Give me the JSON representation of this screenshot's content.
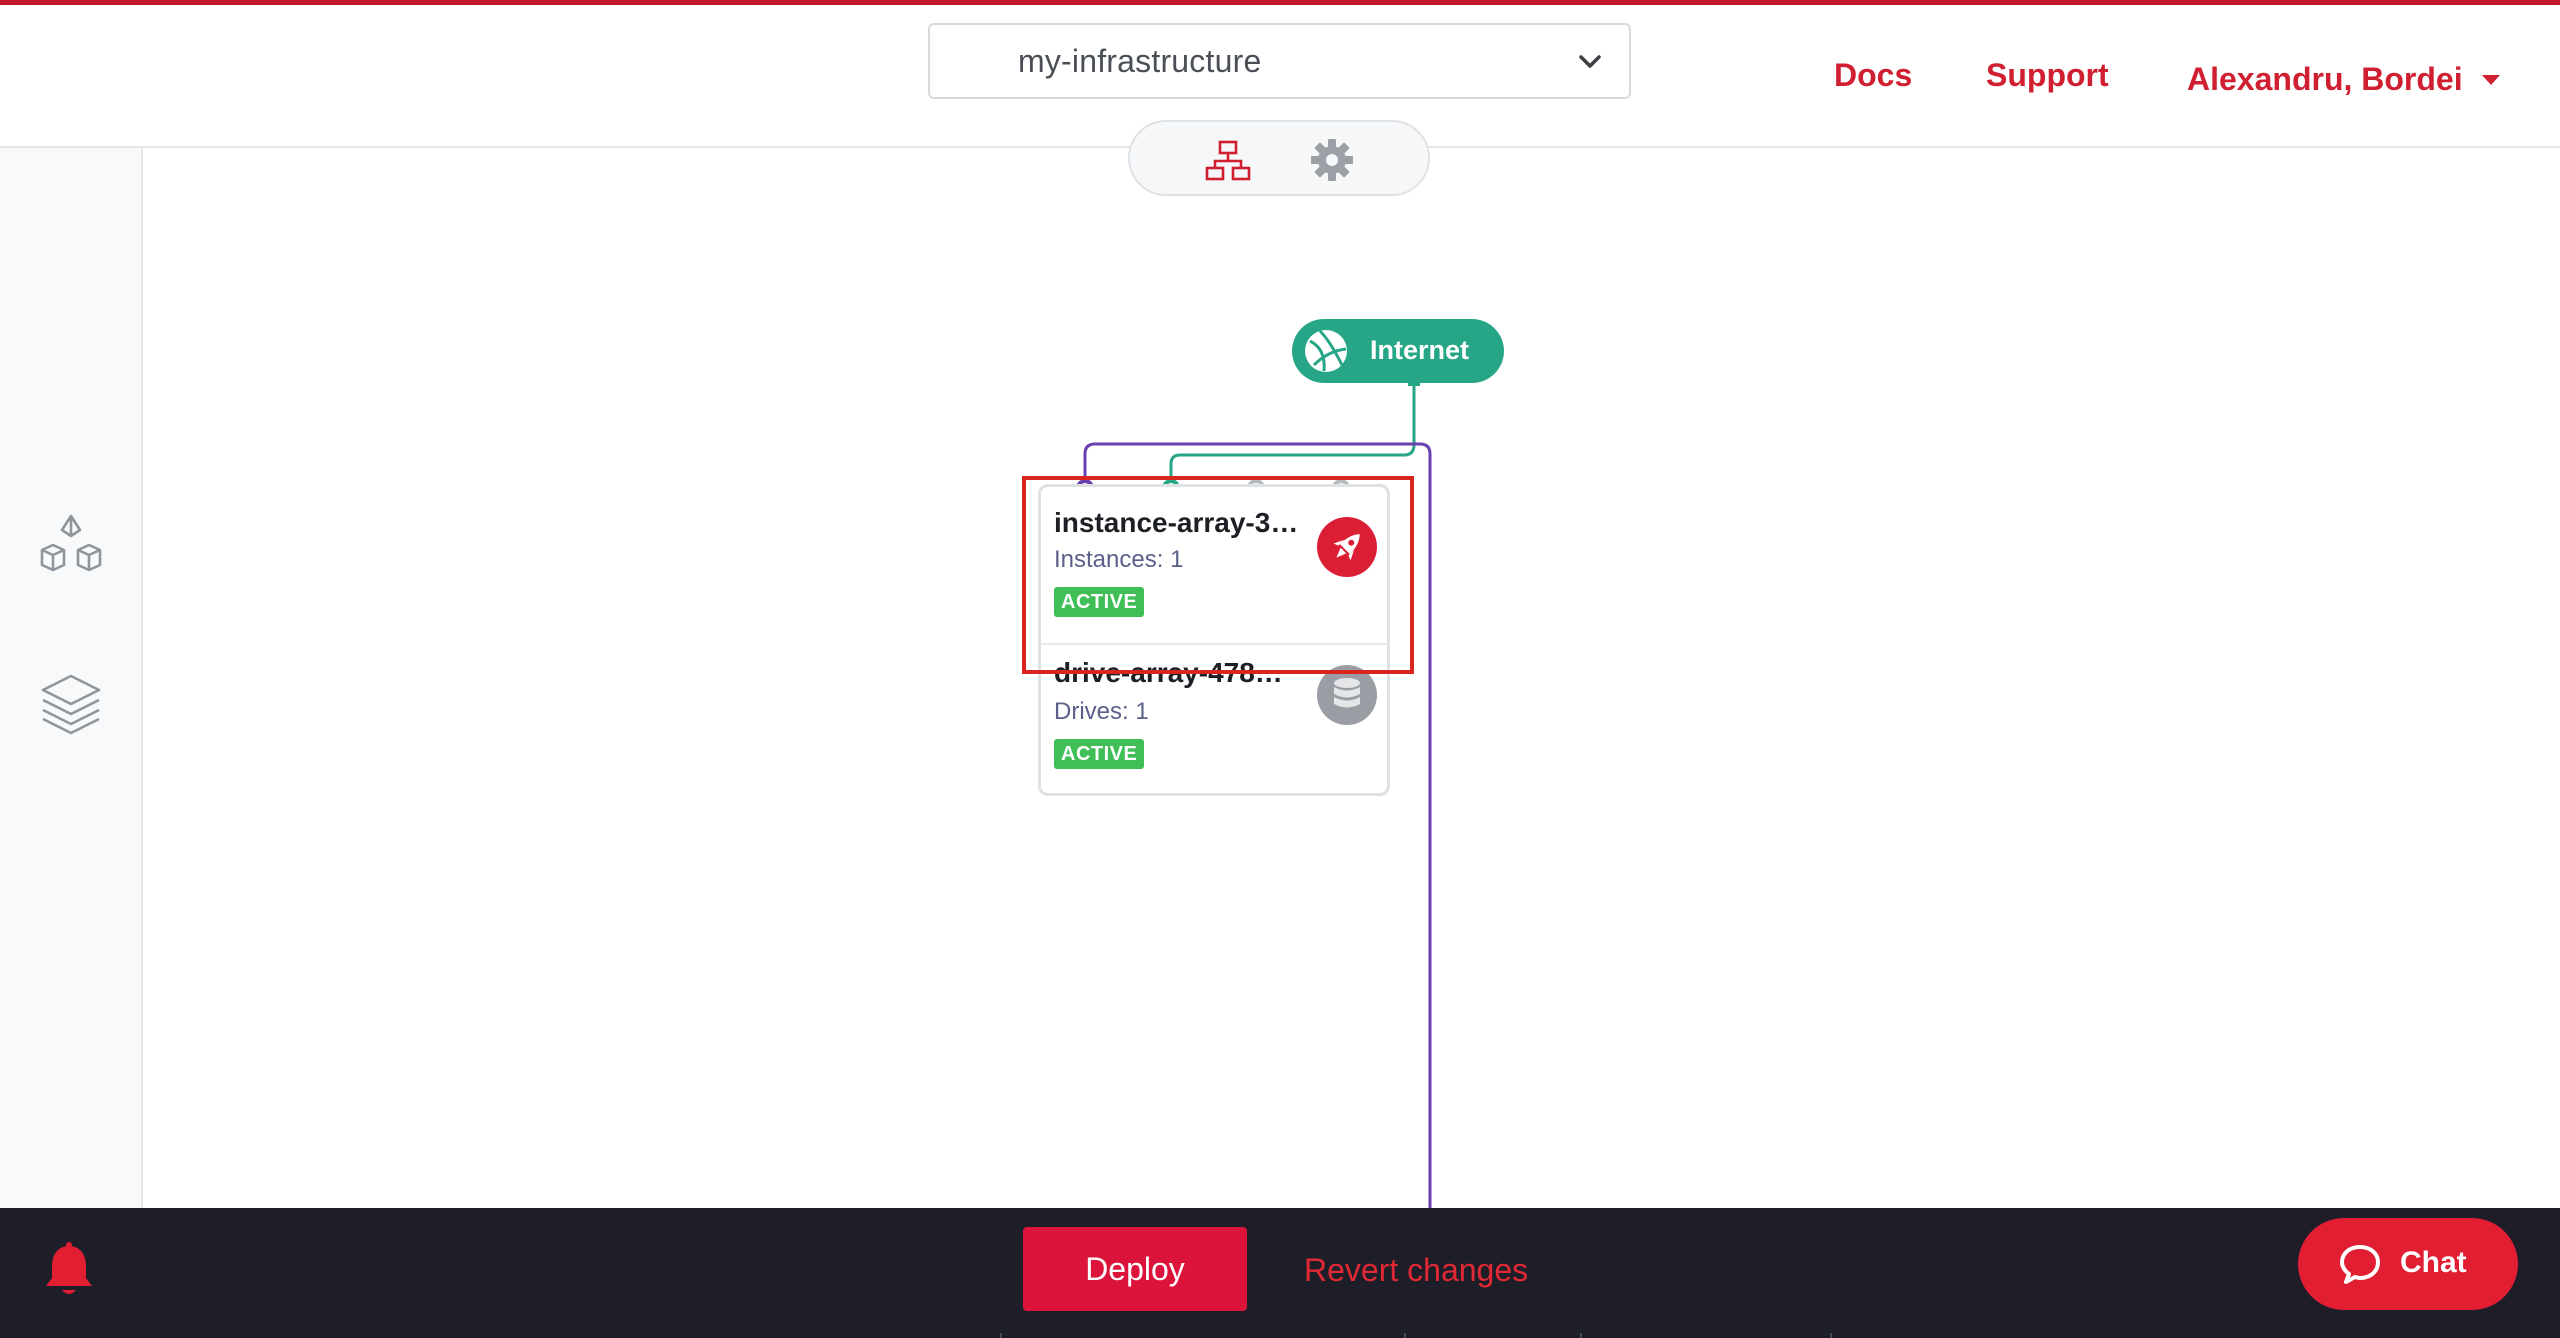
{
  "header": {
    "infrastructure_select": {
      "value": "my-infrastructure"
    },
    "links": {
      "docs": "Docs",
      "support": "Support",
      "user": "Alexandru, Bordei"
    }
  },
  "view_toggle": {
    "icons": [
      "network-topology-icon",
      "gear-icon"
    ]
  },
  "sidebar": {
    "icons": [
      "cubes-icon",
      "layers-icon"
    ]
  },
  "canvas": {
    "internet": {
      "label": "Internet"
    },
    "instance_array": {
      "title": "instance-array-3…",
      "subtitle": "Instances: 1",
      "status": "ACTIVE"
    },
    "drive_array": {
      "title": "drive-array-478…",
      "subtitle": "Drives: 1",
      "status": "ACTIVE"
    }
  },
  "footer": {
    "deploy_label": "Deploy",
    "revert_label": "Revert changes",
    "chat_label": "Chat"
  },
  "colors": {
    "brand_red": "#d01f30",
    "deploy_red": "#dc143c",
    "internet_green": "#27a587",
    "purple_link": "#6a3fb0",
    "active_green": "#3fbf55",
    "footer_bg": "#1d1e27"
  }
}
